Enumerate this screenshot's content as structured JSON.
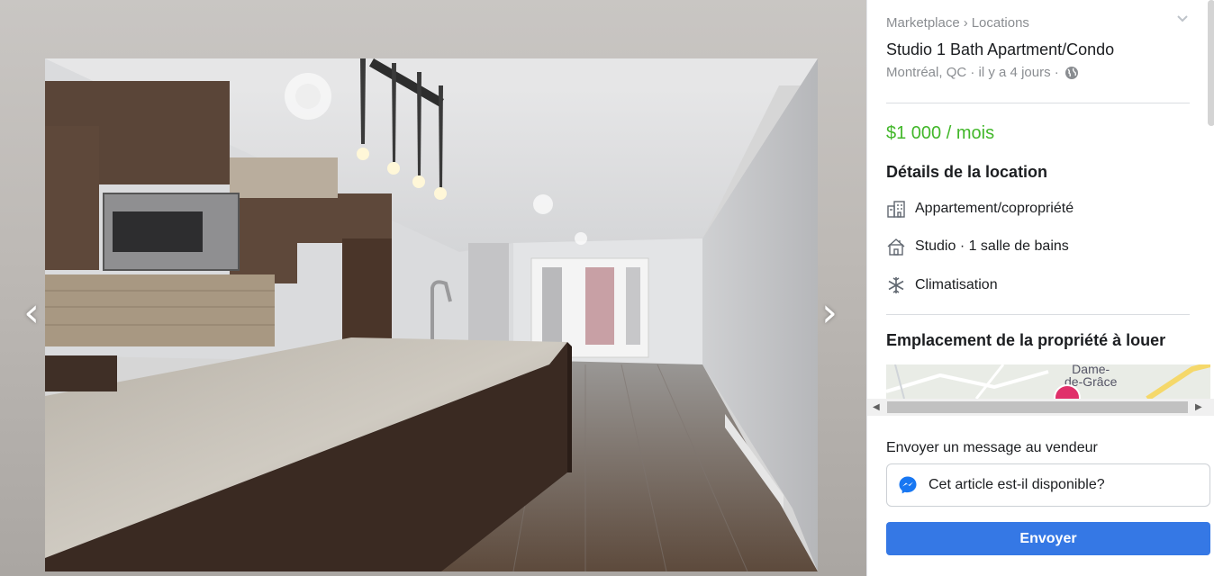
{
  "viewer": {
    "prev_arrow": "‹",
    "next_arrow": "›"
  },
  "breadcrumb": {
    "marketplace": "Marketplace",
    "separator": "›",
    "locations": "Locations"
  },
  "listing": {
    "title": "Studio 1 Bath Apartment/Condo",
    "location": "Montréal, QC",
    "posted": "il y a 4 jours",
    "meta_separator": "·",
    "price": "$1 000 / mois"
  },
  "details": {
    "heading": "Détails de la location",
    "items": [
      {
        "icon": "building-icon",
        "label": "Appartement/copropriété"
      },
      {
        "icon": "house-icon",
        "label": "Studio · 1 salle de bains"
      },
      {
        "icon": "snowflake-icon",
        "label": "Climatisation"
      }
    ]
  },
  "location_section": {
    "heading": "Emplacement de la propriété à louer",
    "map_label_line1": "Dame-",
    "map_label_line2": "de-Grâce"
  },
  "scrollbar": {
    "left": "◀",
    "right": "▶"
  },
  "message": {
    "label": "Envoyer un message au vendeur",
    "value": "Cet article est-il disponible?",
    "send_label": "Envoyer"
  },
  "colors": {
    "price": "#42b72a",
    "send_button": "#3578e5",
    "map_pin": "#e0306a"
  }
}
